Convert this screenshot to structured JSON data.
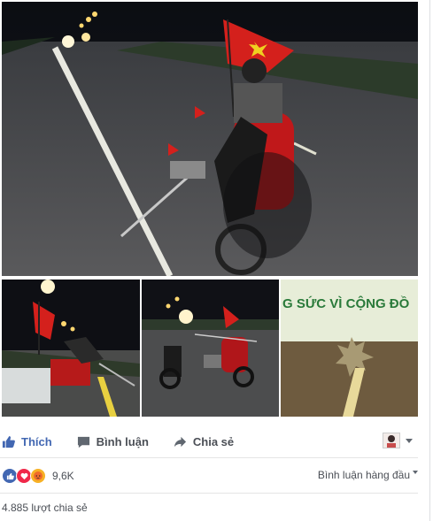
{
  "post": {
    "photos": [
      {
        "id": "main"
      },
      {
        "id": "thumb-1"
      },
      {
        "id": "thumb-2"
      },
      {
        "id": "thumb-3",
        "sign_text": "G SỨC VÌ CỘNG ĐỒ"
      }
    ]
  },
  "actions": {
    "like_label": "Thích",
    "comment_label": "Bình luận",
    "share_label": "Chia sẻ"
  },
  "reactions": {
    "count": "9,6K",
    "icons": [
      "like-icon",
      "love-icon",
      "angry-icon"
    ],
    "sort_label": "Bình luận hàng đầu"
  },
  "shares": {
    "text": "4.885 lượt chia sẻ"
  },
  "colors": {
    "accent": "#4267b2",
    "text": "#4b4f56",
    "love": "#f0284a",
    "angry": "#f7b125"
  }
}
